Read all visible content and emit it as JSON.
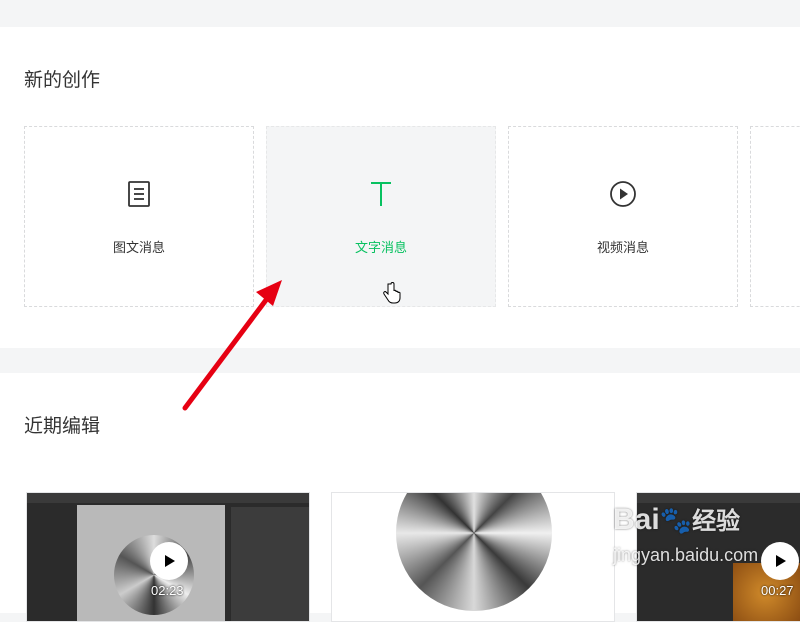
{
  "new_creation": {
    "title": "新的创作",
    "cards": [
      {
        "label": "图文消息",
        "icon": "document-icon"
      },
      {
        "label": "文字消息",
        "icon": "text-t-icon"
      },
      {
        "label": "视频消息",
        "icon": "play-circle-icon"
      }
    ]
  },
  "recent_edits": {
    "title": "近期编辑",
    "items": [
      {
        "duration": "02:23"
      },
      {
        "duration": ""
      },
      {
        "duration": "00:27"
      }
    ]
  },
  "watermark": {
    "brand": "Bai",
    "brand2": "经验",
    "url": "jingyan.baidu.com"
  },
  "colors": {
    "accent": "#07c160",
    "annotation_arrow": "#e60012"
  }
}
